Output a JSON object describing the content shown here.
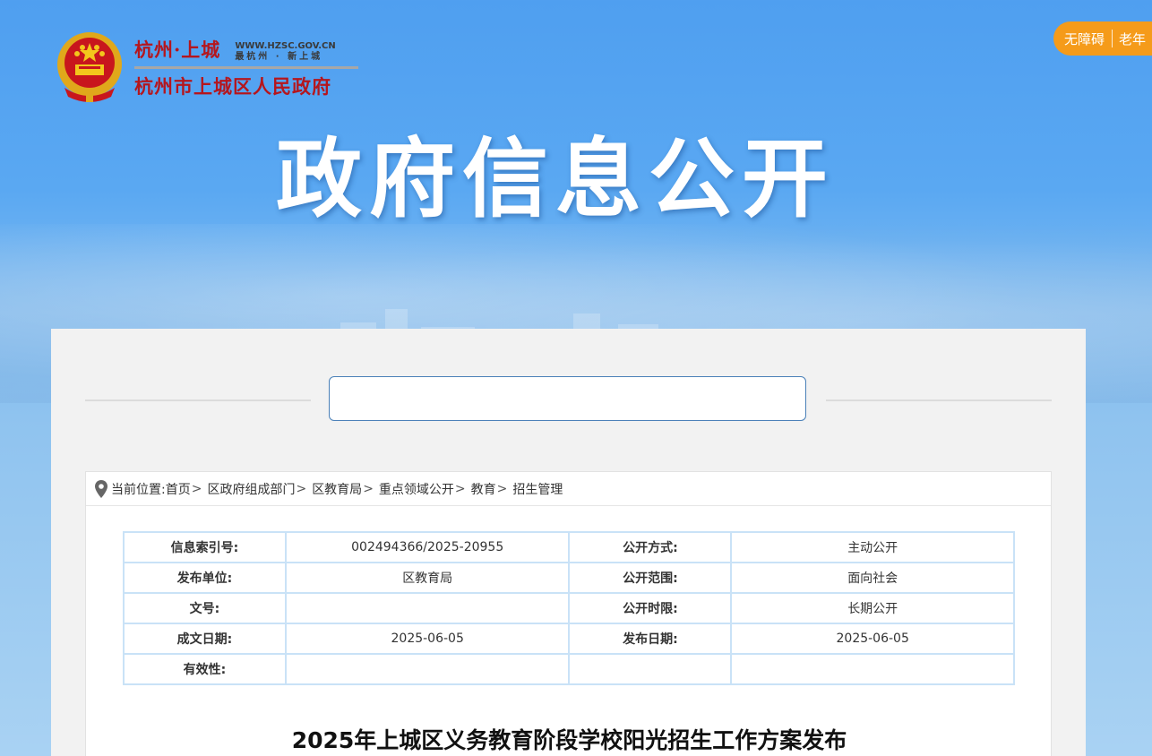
{
  "header": {
    "logo_city": "杭州·上城",
    "logo_url": "WWW.HZSC.GOV.CN",
    "logo_slogan": "最杭州 · 新上城",
    "logo_gov": "杭州市上城区人民政府",
    "banner_title": "政府信息公开"
  },
  "accessibility": {
    "barrier_free": "无障碍",
    "elderly": "老年"
  },
  "search": {
    "value": "",
    "placeholder": ""
  },
  "breadcrumb": {
    "prefix": "当前位置:",
    "items": [
      "首页",
      "区政府组成部门",
      "区教育局",
      "重点领域公开",
      "教育",
      "招生管理"
    ]
  },
  "meta_table": {
    "rows": [
      {
        "k1": "信息索引号:",
        "v1": "002494366/2025-20955",
        "k2": "公开方式:",
        "v2": "主动公开"
      },
      {
        "k1": "发布单位:",
        "v1": "区教育局",
        "k2": "公开范围:",
        "v2": "面向社会"
      },
      {
        "k1": "文号:",
        "v1": "",
        "k2": "公开时限:",
        "v2": "长期公开"
      },
      {
        "k1": "成文日期:",
        "v1": "2025-06-05",
        "k2": "发布日期:",
        "v2": "2025-06-05"
      },
      {
        "k1": "有效性:",
        "v1": "",
        "k2": "",
        "v2": ""
      }
    ]
  },
  "article": {
    "title": "2025年上城区义务教育阶段学校阳光招生工作方案发布"
  },
  "colors": {
    "accent_orange": "#f59b1a",
    "emblem_red": "#b5161d",
    "table_border": "#c9e2f7"
  },
  "icons": {
    "location": "map-pin-icon",
    "emblem": "national-emblem-icon"
  }
}
